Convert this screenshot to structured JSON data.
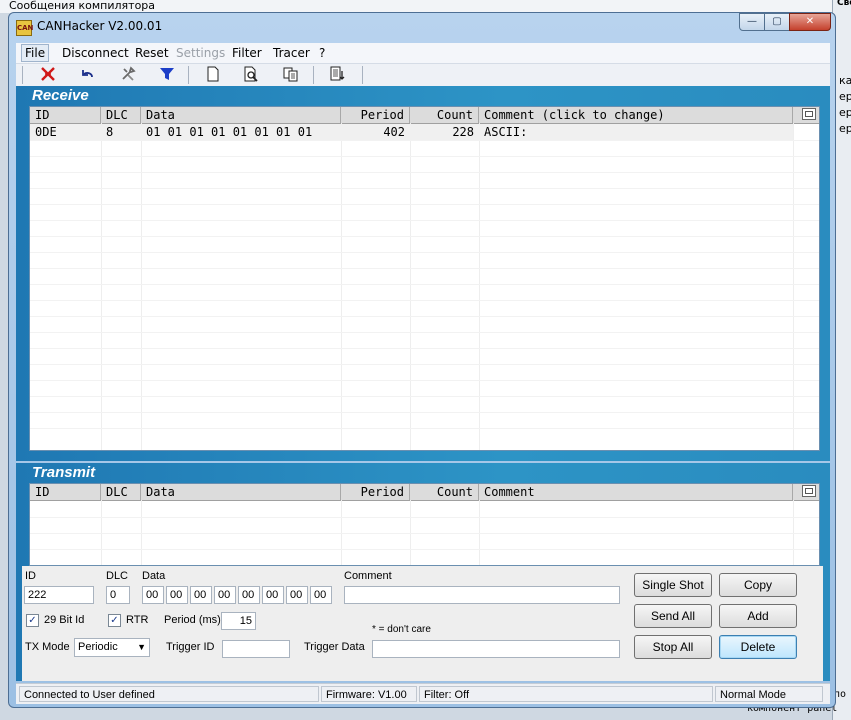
{
  "background": {
    "top_text": "Сообщения компилятора",
    "right_title": "Свойства",
    "right_snippets": [
      "ка",
      "ер",
      "ер",
      "ер"
    ],
    "bottom_text": [
      "мпо",
      "компонент panel"
    ]
  },
  "window": {
    "title": "CANHacker V2.00.01",
    "app_icon_text": "CAN",
    "controls": {
      "minimize": "—",
      "maximize": "▢",
      "close": "✕"
    }
  },
  "menu": [
    {
      "label": "File"
    },
    {
      "label": "Disconnect"
    },
    {
      "label": "Reset"
    },
    {
      "label": "Settings"
    },
    {
      "label": "Filter"
    },
    {
      "label": "Tracer"
    },
    {
      "label": "?"
    }
  ],
  "toolbar": {
    "icons": [
      "disconnect-icon",
      "undo-icon",
      "tools-icon",
      "filter-icon",
      "new-document-icon",
      "preview-icon",
      "copy-icon",
      "log-icon"
    ]
  },
  "receive": {
    "title": "Receive",
    "columns": [
      "ID",
      "DLC",
      "Data",
      "Period",
      "Count",
      "Comment (click to change)"
    ],
    "rows": [
      {
        "id": "0DE",
        "dlc": "8",
        "data": "01 01 01 01 01 01 01 01",
        "period": "402",
        "count": "228",
        "comment": "ASCII:"
      }
    ]
  },
  "transmit": {
    "title": "Transmit",
    "columns": [
      "ID",
      "DLC",
      "Data",
      "Period",
      "Count",
      "Comment"
    ],
    "rows": []
  },
  "tx_form": {
    "labels": {
      "id": "ID",
      "dlc": "DLC",
      "data": "Data",
      "comment": "Comment",
      "bit29": "29 Bit Id",
      "rtr": "RTR",
      "period": "Period (ms)",
      "dont_care": "* = don't care",
      "tx_mode": "TX Mode",
      "trigger_id": "Trigger ID",
      "trigger_data": "Trigger Data"
    },
    "id_value": "222",
    "dlc_value": "0",
    "data_bytes": [
      "00",
      "00",
      "00",
      "00",
      "00",
      "00",
      "00",
      "00"
    ],
    "comment_value": "",
    "bit29_checked": "✓",
    "rtr_checked": "✓",
    "period_value": "15",
    "tx_mode_value": "Periodic",
    "trigger_id_value": "",
    "trigger_data_value": "",
    "buttons": {
      "single_shot": "Single Shot",
      "copy": "Copy",
      "send_all": "Send All",
      "add": "Add",
      "stop_all": "Stop All",
      "delete": "Delete"
    }
  },
  "status": {
    "connection": "Connected to User defined",
    "firmware": "Firmware: V1.00",
    "filter": "Filter: Off",
    "mode": "Normal Mode"
  }
}
